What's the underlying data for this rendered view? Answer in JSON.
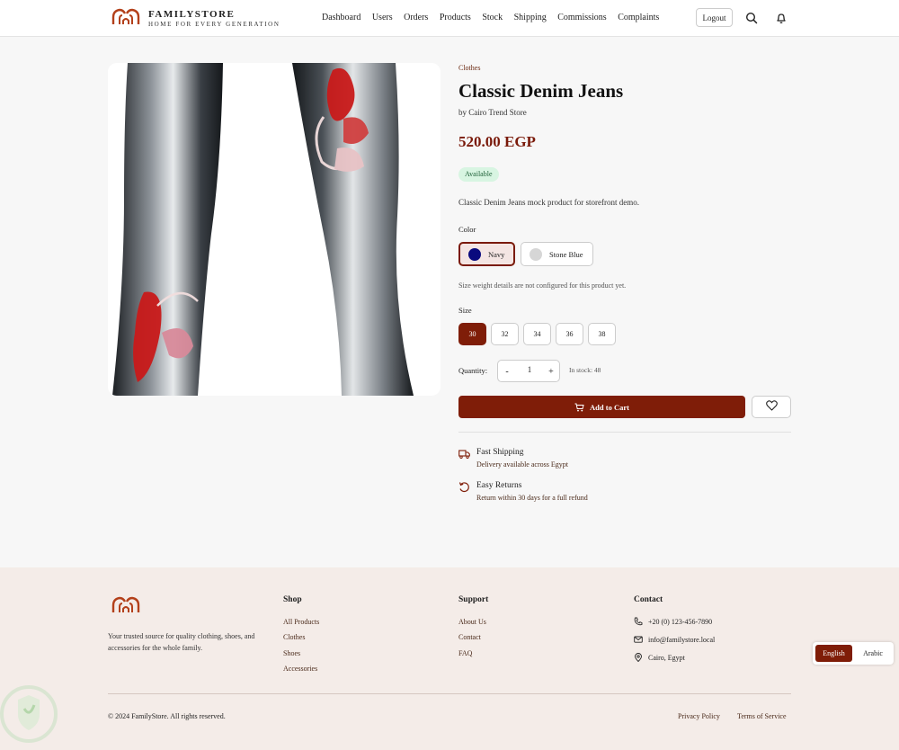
{
  "header": {
    "brand_name": "FAMILYSTORE",
    "brand_tagline": "HOME FOR EVERY GENERATION",
    "nav": [
      "Dashboard",
      "Users",
      "Orders",
      "Products",
      "Stock",
      "Shipping",
      "Commissions",
      "Complaints"
    ],
    "logout_label": "Logout",
    "icons": [
      "search-icon",
      "bell-icon"
    ]
  },
  "product": {
    "category": "Clothes",
    "title": "Classic Denim Jeans",
    "seller": "by Cairo Trend Store",
    "price": "520.00 EGP",
    "status": "Available",
    "description": "Classic Denim Jeans mock product for storefront demo.",
    "color_label": "Color",
    "colors": [
      {
        "name": "Navy",
        "hex": "#0a0a7e",
        "selected": true
      },
      {
        "name": "Stone Blue",
        "hex": "#d6d6d6",
        "selected": false
      }
    ],
    "size_note": "Size weight details are not configured for this product yet.",
    "size_label": "Size",
    "sizes": [
      {
        "value": "30",
        "selected": true
      },
      {
        "value": "32",
        "selected": false
      },
      {
        "value": "34",
        "selected": false
      },
      {
        "value": "36",
        "selected": false
      },
      {
        "value": "38",
        "selected": false
      }
    ],
    "quantity_label": "Quantity:",
    "quantity": "1",
    "qty_minus": "-",
    "qty_plus": "+",
    "stock_text": "In stock: 48",
    "add_to_cart": "Add to Cart",
    "features": [
      {
        "title": "Fast Shipping",
        "subtitle": "Delivery available across Egypt",
        "icon": "truck-icon"
      },
      {
        "title": "Easy Returns",
        "subtitle": "Return within 30 days for a full refund",
        "icon": "rotate-ccw-icon"
      }
    ]
  },
  "footer": {
    "about": "Your trusted source for quality clothing, shoes, and accessories for the whole family.",
    "shop_title": "Shop",
    "shop_links": [
      "All Products",
      "Clothes",
      "Shoes",
      "Accessories"
    ],
    "support_title": "Support",
    "support_links": [
      "About Us",
      "Contact",
      "FAQ"
    ],
    "contact_title": "Contact",
    "contact": {
      "phone": "+20 (0) 123-456-7890",
      "email": "info@familystore.local",
      "address": "Cairo, Egypt"
    },
    "copyright": "© 2024 FamilyStore. All rights reserved.",
    "privacy": "Privacy Policy",
    "terms": "Terms of Service"
  },
  "language": {
    "english": "English",
    "arabic": "Arabic",
    "active": "English"
  },
  "colors": {
    "brand": "#7f1d08",
    "price": "#7a1a0a",
    "footer_bg": "#f4ece8",
    "available_bg": "#d8f5e2"
  }
}
